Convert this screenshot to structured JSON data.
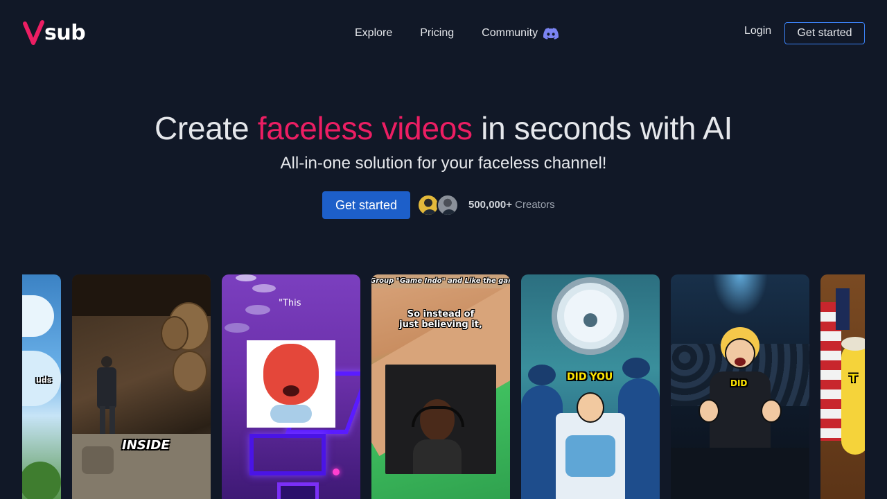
{
  "brand": {
    "logo_text": "sub",
    "accent": "#ec1e63",
    "primary": "#1d5fc9"
  },
  "nav": {
    "explore": "Explore",
    "pricing": "Pricing",
    "community": "Community",
    "community_icon": "discord-icon",
    "login": "Login",
    "get_started": "Get started"
  },
  "hero": {
    "title_pre": "Create",
    "title_accent": "faceless videos",
    "title_post": "in seconds with AI",
    "subtitle": "All-in-one solution for your faceless channel!",
    "cta": "Get started",
    "creators_count": "500,000+",
    "creators_label": "Creators"
  },
  "videos": [
    {
      "caption": "uds"
    },
    {
      "caption": "INSIDE"
    },
    {
      "caption": "\"This"
    },
    {
      "caption_top": "Group \"Game Indo\" and Like the game",
      "caption": "So instead of just believing it,"
    },
    {
      "caption": "DID YOU"
    },
    {
      "caption": "DID"
    },
    {
      "caption": "T"
    }
  ]
}
